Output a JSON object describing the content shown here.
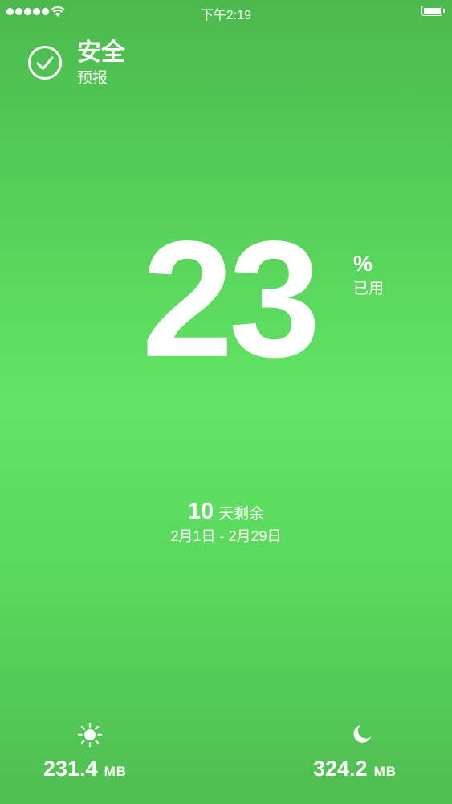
{
  "status_bar": {
    "time": "下午2:19",
    "signal_bars": 5
  },
  "header": {
    "icon": "checkmark-circle-icon",
    "title": "安全",
    "subtitle": "预报"
  },
  "usage": {
    "percent": "23",
    "unit": "%",
    "label": "已用"
  },
  "remaining": {
    "days": "10",
    "label": "天剩余",
    "period": "2月1日 - 2月29日"
  },
  "stats": {
    "day": {
      "icon": "sun-icon",
      "value": "231.4",
      "unit": "MB"
    },
    "night": {
      "icon": "moon-icon",
      "value": "324.2",
      "unit": "MB"
    }
  },
  "colors": {
    "background_top": "#4cb94f",
    "background_middle": "#62e466",
    "text": "#ffffff"
  }
}
